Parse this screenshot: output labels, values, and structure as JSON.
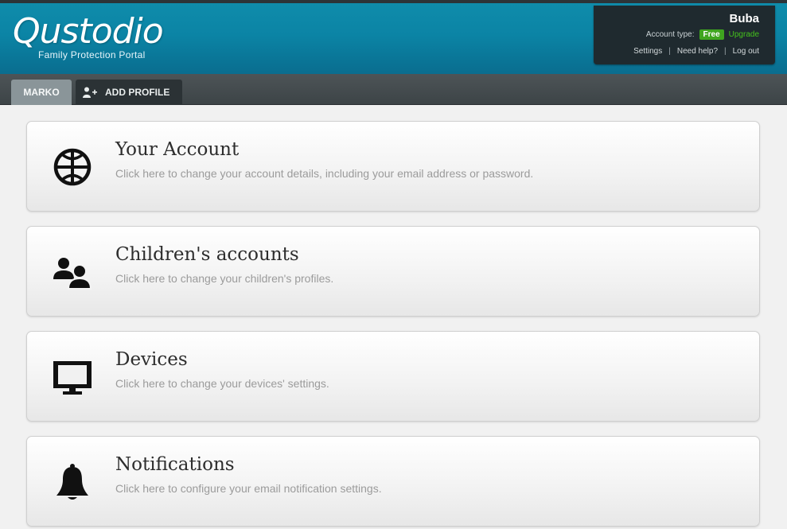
{
  "header": {
    "logo": "Qustodio",
    "tagline": "Family Protection Portal"
  },
  "user": {
    "name": "Buba",
    "account_type_label": "Account type:",
    "account_type": "Free",
    "upgrade_label": "Upgrade",
    "links": {
      "settings": "Settings",
      "help": "Need help?",
      "logout": "Log out"
    },
    "separator": "|"
  },
  "tabs": {
    "profile": "MARKO",
    "add_profile": "ADD PROFILE"
  },
  "cards": [
    {
      "icon": "globe-icon",
      "title": "Your Account",
      "description": "Click here to change your account details, including your email address or password."
    },
    {
      "icon": "users-icon",
      "title": "Children's accounts",
      "description": "Click here to change your children's profiles."
    },
    {
      "icon": "monitor-icon",
      "title": "Devices",
      "description": "Click here to change your devices' settings."
    },
    {
      "icon": "bell-icon",
      "title": "Notifications",
      "description": "Click here to configure your email notification settings."
    }
  ],
  "colors": {
    "header_blue": "#0b84a5",
    "free_badge": "#3fa51f",
    "upgrade_green": "#45c21c"
  }
}
